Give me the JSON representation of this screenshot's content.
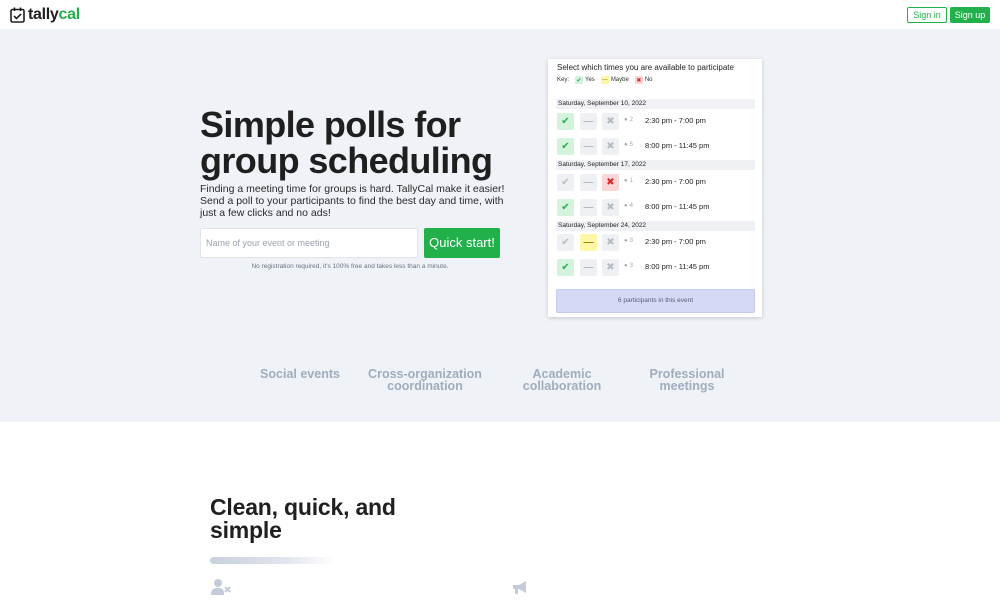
{
  "header": {
    "brand_part1": "tally",
    "brand_part2": "cal",
    "signin_label": "Sign in",
    "signup_label": "Sign up"
  },
  "hero": {
    "title": "Simple polls for group scheduling",
    "description": "Finding a meeting time for groups is hard. TallyCal make it easier! Send a poll to your participants to find the best day and time, with just a few clicks and no ads!",
    "input_placeholder": "Name of your event or meeting",
    "cta_label": "Quick start!",
    "note": "No registration required, it's 100% free and takes less than a minute."
  },
  "poll": {
    "heading": "Select which times you are available to participate",
    "key_label": "Key:",
    "key_yes": "Yes",
    "key_maybe": "Maybe",
    "key_no": "No",
    "dates": [
      {
        "label": "Saturday, September 10, 2022",
        "slots": [
          {
            "count": "2",
            "time": "2:30 pm - 7:00 pm",
            "choice": "yes"
          },
          {
            "count": "5",
            "time": "8:00 pm - 11:45 pm",
            "choice": "yes"
          }
        ]
      },
      {
        "label": "Saturday, September 17, 2022",
        "slots": [
          {
            "count": "1",
            "time": "2:30 pm - 7:00 pm",
            "choice": "no"
          },
          {
            "count": "4",
            "time": "8:00 pm - 11:45 pm",
            "choice": "yes"
          }
        ]
      },
      {
        "label": "Saturday, September 24, 2022",
        "slots": [
          {
            "count": "3",
            "time": "2:30 pm - 7:00 pm",
            "choice": "maybe"
          },
          {
            "count": "3",
            "time": "8:00 pm - 11:45 pm",
            "choice": "yes"
          }
        ]
      }
    ],
    "footer": "6 participants in this event"
  },
  "categories": [
    "Social events",
    "Cross-organization coordination",
    "Academic collaboration",
    "Professional meetings"
  ],
  "section2": {
    "title": "Clean, quick, and simple",
    "icons": [
      "user-x-icon",
      "megaphone-icon"
    ]
  },
  "colors": {
    "brand_green": "#22b04b",
    "hero_bg": "#eff2f7",
    "category_text": "#9fadbd"
  }
}
